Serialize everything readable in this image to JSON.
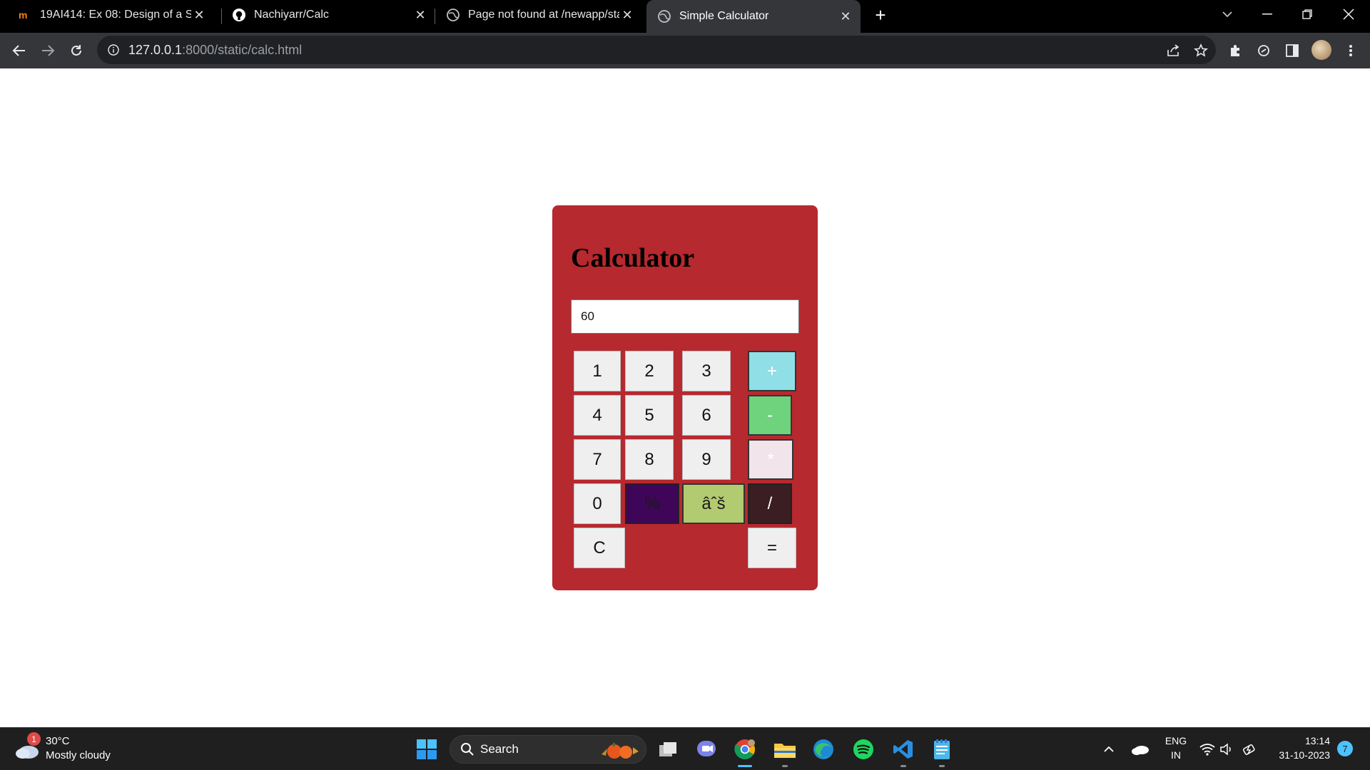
{
  "browser": {
    "tabs": [
      {
        "title": "19AI414: Ex 08: Design of a Stan",
        "favicon": "moodle-icon"
      },
      {
        "title": "Nachiyarr/Calc",
        "favicon": "github-icon"
      },
      {
        "title": "Page not found at /newapp/stat",
        "favicon": "globe-icon"
      },
      {
        "title": "Simple Calculator",
        "favicon": "globe-icon",
        "active": true
      }
    ],
    "url_host": "127.0.0.1",
    "url_path": ":8000/static/calc.html"
  },
  "calculator": {
    "title": "Calculator",
    "display_value": "60",
    "keys": {
      "k1": "1",
      "k2": "2",
      "k3": "3",
      "plus": "+",
      "k4": "4",
      "k5": "5",
      "k6": "6",
      "minus": "-",
      "k7": "7",
      "k8": "8",
      "k9": "9",
      "multiply": "*",
      "k0": "0",
      "percent": "%",
      "sqrt": "âˆš",
      "divide": "/",
      "clear": "C",
      "equals": "="
    },
    "colors": {
      "panel": "#b6292e",
      "plus": "#90dfe6",
      "minus": "#6ed37c",
      "multiply": "#f1e4ea",
      "divide": "#3b1e22",
      "percent": "#3e0558",
      "sqrt": "#b2cb70"
    }
  },
  "taskbar": {
    "weather_badge": "1",
    "temperature": "30°C",
    "condition": "Mostly cloudy",
    "search_label": "Search",
    "lang_top": "ENG",
    "lang_bottom": "IN",
    "time": "13:14",
    "date": "31-10-2023",
    "notification_count": "7"
  }
}
